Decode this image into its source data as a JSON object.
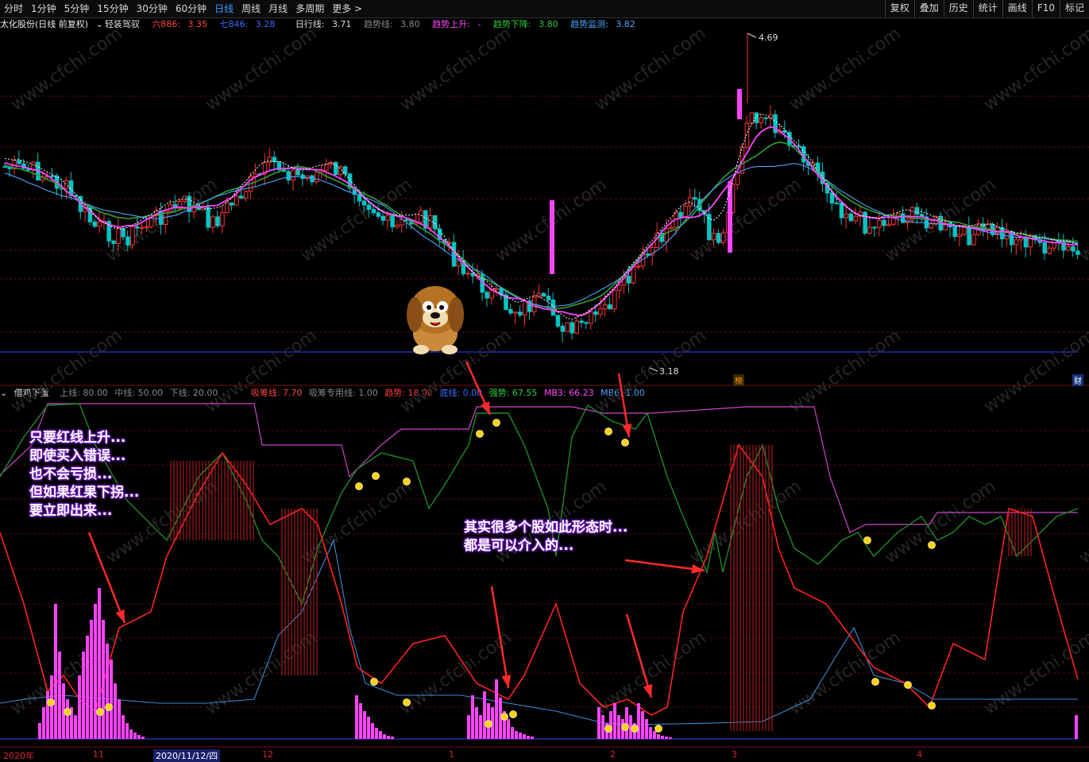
{
  "periods": [
    "分时",
    "1分钟",
    "5分钟",
    "15分钟",
    "30分钟",
    "60分钟",
    "日线",
    "周线",
    "月线",
    "多周期",
    "更多"
  ],
  "active_period": "日线",
  "tools": [
    "复权",
    "叠加",
    "历史",
    "统计",
    "画线",
    "F10",
    "标记"
  ],
  "main_info": {
    "stock": "太化股份(日线 前复权)",
    "indicator": "轻装驾驭",
    "ma6_label": "六886:",
    "ma6": "3.35",
    "ma7_label": "七846:",
    "ma7": "3.28",
    "daily_label": "日行线:",
    "daily": "3.71",
    "trend_label": "趋势线:",
    "trend": "3.80",
    "up_label": "趋势上升:",
    "up": "-",
    "down_label": "趋势下降:",
    "down": "3.80",
    "monitor_label": "趋势监测:",
    "monitor": "3.82"
  },
  "price_high": "4.69",
  "price_low": "3.18",
  "badge_bang": "榜",
  "badge_cai": "财",
  "sub_info": {
    "name": "借鸡下蛋",
    "upper": "上线: 80.00",
    "mid": "中线: 50.00",
    "lower": "下线: 20.00",
    "absorb": "吸筹线: 7.70",
    "absorb_special": "吸筹专用线: 1.00",
    "trend": "趋势: 18.00",
    "base": "底线: 0.00",
    "strong": "强势: 67.55",
    "mb3": "MB3: 66.23",
    "mb6": "MB6: 1.00"
  },
  "callout_left": [
    "只要红线上升...",
    "即使买入错误...",
    "也不会亏损...",
    "但如果红果下拐...",
    "要立即出来..."
  ],
  "callout_right": [
    "其实很多个股如此形态时...",
    "都是可以介入的..."
  ],
  "bottom_axis": {
    "year": "2020年",
    "m11": "11",
    "selected_date": "2020/11/12/四",
    "m12": "12",
    "m1": "1",
    "m2": "2",
    "m3": "3",
    "m4": "4"
  },
  "watermark": "www.cfchi.com"
}
